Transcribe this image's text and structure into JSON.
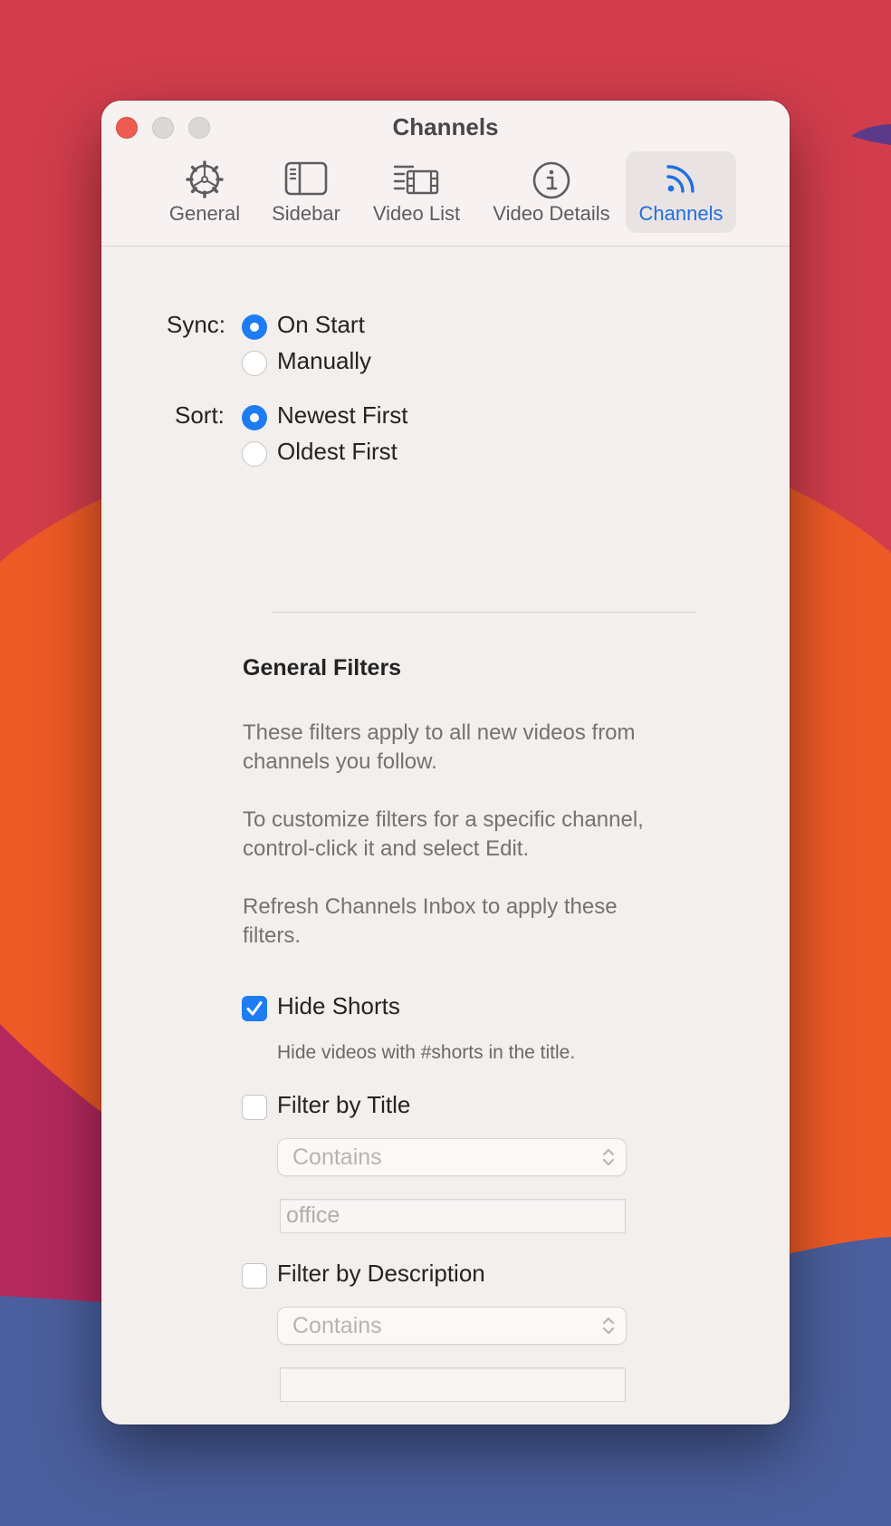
{
  "window": {
    "title": "Channels"
  },
  "toolbar": {
    "tabs": [
      {
        "label": "General",
        "icon": "gear-icon"
      },
      {
        "label": "Sidebar",
        "icon": "sidebar-icon"
      },
      {
        "label": "Video List",
        "icon": "video-list-icon"
      },
      {
        "label": "Video Details",
        "icon": "info-icon"
      },
      {
        "label": "Channels",
        "icon": "rss-icon",
        "selected": true
      }
    ]
  },
  "sync": {
    "label": "Sync:",
    "options": [
      {
        "label": "On Start",
        "selected": true
      },
      {
        "label": "Manually",
        "selected": false
      }
    ]
  },
  "sort": {
    "label": "Sort:",
    "options": [
      {
        "label": "Newest First",
        "selected": true
      },
      {
        "label": "Oldest First",
        "selected": false
      }
    ]
  },
  "filters": {
    "heading": "General Filters",
    "description": [
      "These filters apply to all new videos from channels you follow.",
      "To customize filters for a specific channel, control-click it and select Edit.",
      "Refresh Channels Inbox to apply these filters."
    ],
    "hide_shorts": {
      "label": "Hide Shorts",
      "checked": true,
      "hint": "Hide videos with #shorts in the title."
    },
    "by_title": {
      "label": "Filter by Title",
      "checked": false,
      "condition": "Contains",
      "value": "office"
    },
    "by_description": {
      "label": "Filter by Description",
      "checked": false,
      "condition": "Contains",
      "value": ""
    }
  },
  "colors": {
    "accent": "#1d7cf2",
    "close_button": "#ee5b52",
    "selected_tab_text": "#1f6fe0"
  }
}
